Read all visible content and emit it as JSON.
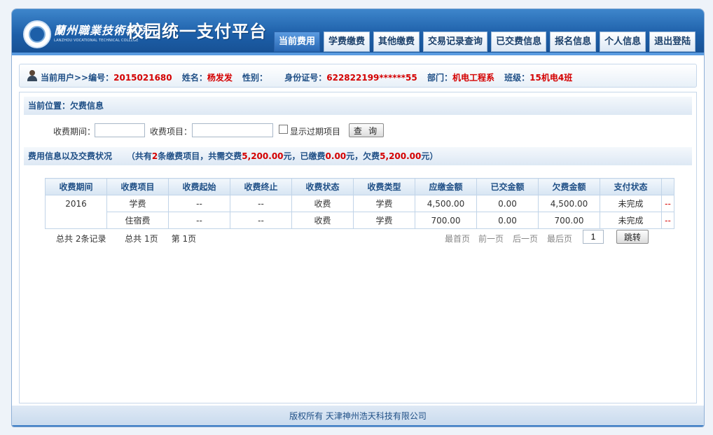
{
  "header": {
    "school_name_cn": "蘭州職業技術學院",
    "school_name_en": "LANZHOU VOCATIONAL TECHNICAL COLLEGE",
    "site_title": "校园统一支付平台",
    "nav": [
      "当前费用",
      "学费缴费",
      "其他缴费",
      "交易记录查询",
      "已交费信息",
      "报名信息",
      "个人信息",
      "退出登陆"
    ],
    "active_nav": "当前费用"
  },
  "user": {
    "label_current": "当前用户>>编号：",
    "id": "2015021680",
    "label_name": "姓名：",
    "name": "杨发发",
    "label_gender": "性别：",
    "gender": "",
    "label_idcard": "身份证号：",
    "idcard": "622822199******55",
    "label_dept": "部门：",
    "dept": "机电工程系",
    "label_class": "班级：",
    "class": "15机电4班"
  },
  "location": "当前位置：欠费信息",
  "search": {
    "period_label": "收费期间：",
    "period_value": "",
    "item_label": "收费项目：",
    "item_value": "",
    "show_expired_label": "显示过期项目",
    "show_expired_checked": false,
    "query_button": "查 询"
  },
  "summary": {
    "title": "费用信息以及交费状况",
    "p1": "（共有",
    "count": "2",
    "p2": "条缴费项目，共需交费",
    "total_due": "5,200.00",
    "p3": "元，已缴费",
    "paid": "0.00",
    "p4": "元，欠费",
    "owed": "5,200.00",
    "p5": "元）"
  },
  "table": {
    "headers": [
      "收费期间",
      "收费项目",
      "收费起始",
      "收费终止",
      "收费状态",
      "收费类型",
      "应缴金额",
      "已交金额",
      "欠费金额",
      "支付状态",
      ""
    ],
    "period": "2016",
    "rows": [
      {
        "item": "学费",
        "start": "--",
        "end": "--",
        "status": "收费",
        "type": "学费",
        "due": "4,500.00",
        "paid": "0.00",
        "owed": "4,500.00",
        "pay_status": "未完成",
        "action": "--"
      },
      {
        "item": "住宿费",
        "start": "--",
        "end": "--",
        "status": "收费",
        "type": "学费",
        "due": "700.00",
        "paid": "0.00",
        "owed": "700.00",
        "pay_status": "未完成",
        "action": "--"
      }
    ]
  },
  "pager": {
    "total_records": "总共  2条记录",
    "total_pages": "总共  1页",
    "current_page": "第 1页",
    "first": "最首页",
    "prev": "前一页",
    "next": "后一页",
    "last": "最后页",
    "page_input": "1",
    "jump_button": "跳转"
  },
  "footer": "版权所有 天津神州浩天科技有限公司"
}
